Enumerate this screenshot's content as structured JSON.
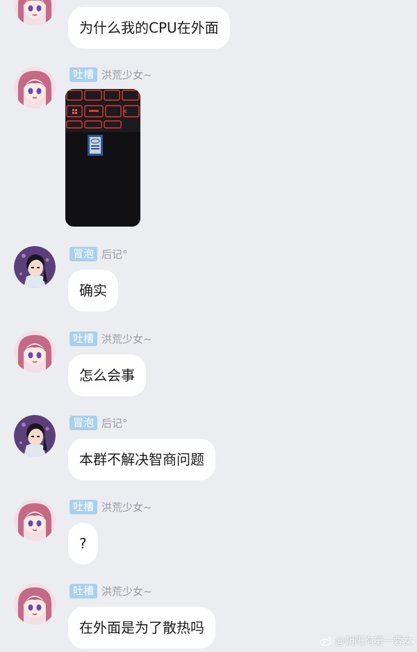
{
  "users": {
    "tucao": {
      "badge": "吐槽",
      "nick": "洪荒少女~"
    },
    "maopao": {
      "badge": "冒泡",
      "nick": "后记°"
    }
  },
  "messages": [
    {
      "text": "为什么我的CPU在外面"
    },
    {
      "badge": "吐槽",
      "nick": "洪荒少女~",
      "image": "photo-of-laptop-keyboard-with-intel-sticker"
    },
    {
      "badge": "冒泡",
      "nick": "后记°",
      "text": "确实"
    },
    {
      "badge": "吐槽",
      "nick": "洪荒少女~",
      "text": "怎么会事"
    },
    {
      "badge": "冒泡",
      "nick": "后记°",
      "text": "本群不解决智商问题"
    },
    {
      "badge": "吐槽",
      "nick": "洪荒少女~",
      "text": "?"
    },
    {
      "badge": "吐槽",
      "nick": "洪荒少女~",
      "text": "在外面是为了散热吗"
    }
  ],
  "watermark": "@朝阳沟第一蓉女",
  "colors": {
    "background": "#ecedf1",
    "badge": "#a9d0ee",
    "bubble": "#ffffff",
    "nick": "#9a9ba3"
  }
}
